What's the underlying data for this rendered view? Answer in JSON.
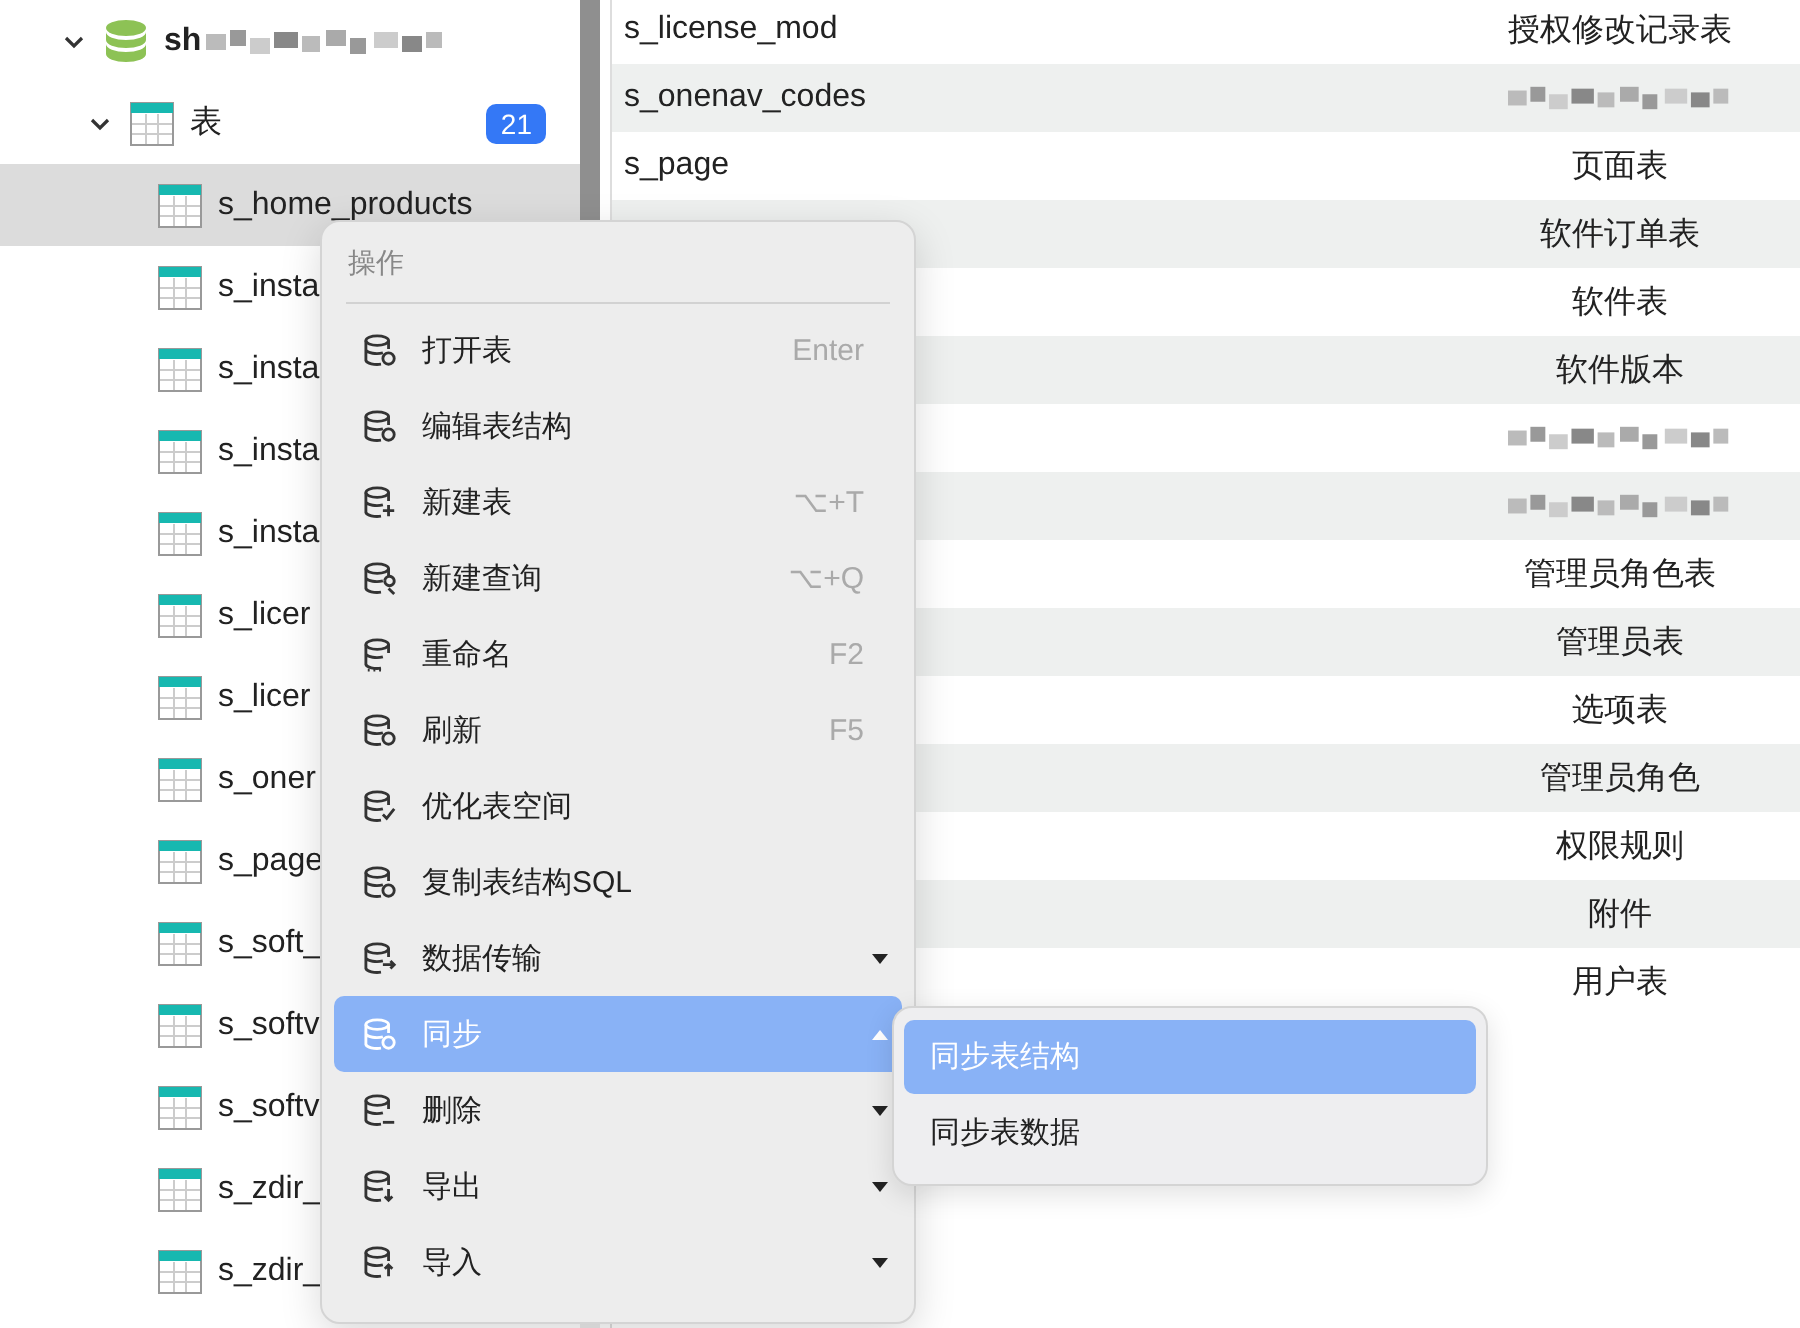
{
  "sidebar": {
    "database": {
      "name": "sh",
      "redacted": true,
      "expanded": true
    },
    "group": {
      "label": "表",
      "count": "21",
      "expanded": true
    },
    "tables": [
      {
        "name": "s_home_products",
        "selected": true
      },
      {
        "name": "s_insta",
        "selected": false
      },
      {
        "name": "s_insta",
        "selected": false
      },
      {
        "name": "s_insta",
        "selected": false
      },
      {
        "name": "s_insta",
        "selected": false
      },
      {
        "name": "s_licer",
        "selected": false
      },
      {
        "name": "s_licer",
        "selected": false
      },
      {
        "name": "s_oner",
        "selected": false
      },
      {
        "name": "s_page",
        "selected": false
      },
      {
        "name": "s_soft_",
        "selected": false
      },
      {
        "name": "s_softv",
        "selected": false
      },
      {
        "name": "s_softv",
        "selected": false
      },
      {
        "name": "s_zdir_",
        "selected": false
      },
      {
        "name": "s_zdir_",
        "selected": false
      }
    ]
  },
  "table": {
    "rows": [
      {
        "name": "s_license_mod",
        "comment": "授权修改记录表"
      },
      {
        "name": "s_onenav_codes",
        "kind": "redacted"
      },
      {
        "name": "s_page",
        "comment": "页面表"
      },
      {
        "comment": "软件订单表"
      },
      {
        "comment": "软件表"
      },
      {
        "comment": "软件版本"
      },
      {
        "kind": "redacted"
      },
      {
        "kind": "redacted"
      },
      {
        "comment": "管理员角色表"
      },
      {
        "comment": "管理员表"
      },
      {
        "comment": "选项表"
      },
      {
        "comment": "管理员角色"
      },
      {
        "comment": "权限规则"
      },
      {
        "comment": "附件"
      },
      {
        "comment": "用户表"
      }
    ]
  },
  "context_menu": {
    "title": "操作",
    "items": [
      {
        "label": "打开表",
        "shortcut": "Enter",
        "submenu": false,
        "selected": false
      },
      {
        "label": "编辑表结构",
        "submenu": false,
        "selected": false
      },
      {
        "label": "新建表",
        "shortcut": "⌥+T",
        "submenu": false,
        "selected": false
      },
      {
        "label": "新建查询",
        "shortcut": "⌥+Q",
        "submenu": false,
        "selected": false
      },
      {
        "label": "重命名",
        "shortcut": "F2",
        "submenu": false,
        "selected": false
      },
      {
        "label": "刷新",
        "shortcut": "F5",
        "submenu": false,
        "selected": false
      },
      {
        "label": "优化表空间",
        "submenu": false,
        "selected": false
      },
      {
        "label": "复制表结构SQL",
        "submenu": false,
        "selected": false
      },
      {
        "label": "数据传输",
        "submenu": true,
        "selected": false
      },
      {
        "label": "同步",
        "submenu": true,
        "selected": true
      },
      {
        "label": "删除",
        "submenu": true,
        "selected": false
      },
      {
        "label": "导出",
        "submenu": true,
        "selected": false
      },
      {
        "label": "导入",
        "submenu": true,
        "selected": false
      }
    ]
  },
  "submenu": {
    "items": [
      {
        "label": "同步表结构",
        "selected": true
      },
      {
        "label": "同步表数据",
        "selected": false
      }
    ]
  }
}
